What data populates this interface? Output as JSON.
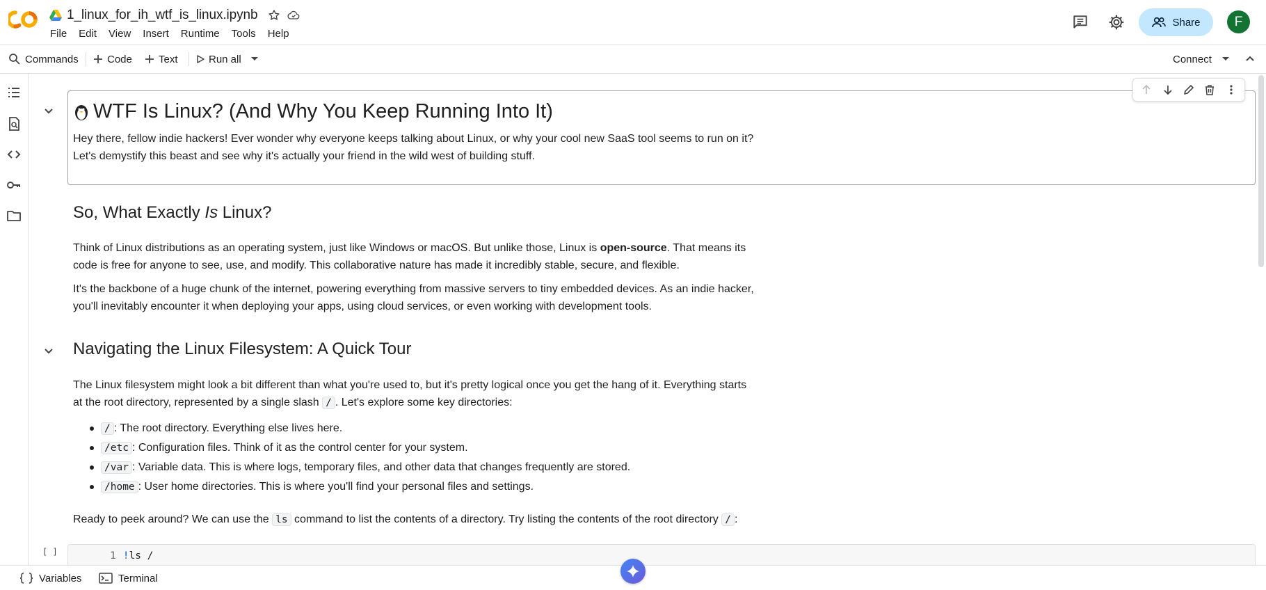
{
  "header": {
    "notebook_title": "1_linux_for_ih_wtf_is_linux.ipynb",
    "menu": [
      "File",
      "Edit",
      "View",
      "Insert",
      "Runtime",
      "Tools",
      "Help"
    ],
    "share_label": "Share",
    "avatar_initial": "F"
  },
  "toolbar": {
    "commands_label": "Commands",
    "code_label": "Code",
    "text_label": "Text",
    "run_all_label": "Run all",
    "connect_label": "Connect"
  },
  "notebook": {
    "h1_title": "WTF Is Linux? (And Why You Keep Running Into It)",
    "intro_line1": "Hey there, fellow indie hackers! Ever wonder why everyone keeps talking about Linux, or why your cool new SaaS tool seems to run on it?",
    "intro_line2": "Let's demystify this beast and see why it's actually your friend in the wild west of building stuff.",
    "h2_what_pre": "So, What Exactly ",
    "h2_what_em": "Is",
    "h2_what_post": " Linux?",
    "p1_pre": "Think of Linux distributions as an operating system, just like Windows or macOS. But unlike those, Linux is ",
    "p1_bold": "open-source",
    "p1_post1": ". That means its",
    "p1_line2": "code is free for anyone to see, use, and modify. This collaborative nature has made it incredibly stable, secure, and flexible.",
    "p2_line1": "It's the backbone of a huge chunk of the internet, powering everything from massive servers to tiny embedded devices. As an indie hacker,",
    "p2_line2": "you'll inevitably encounter it when deploying your apps, using cloud services, or even working with development tools.",
    "h2_nav": "Navigating the Linux Filesystem: A Quick Tour",
    "p3_line1": "The Linux filesystem might look a bit different than what you're used to, but it's pretty logical once you get the hang of it. Everything starts",
    "p3_line2_pre": "at the root directory, represented by a single slash ",
    "p3_code": "/",
    "p3_line2_post": ". Let's explore some key directories:",
    "dirs": [
      {
        "code": "/",
        "desc": ": The root directory. Everything else lives here."
      },
      {
        "code": "/etc",
        "desc": ": Configuration files. Think of it as the control center for your system."
      },
      {
        "code": "/var",
        "desc": ": Variable data. This is where logs, temporary files, and other data that changes frequently are stored."
      },
      {
        "code": "/home",
        "desc": ": User home directories. This is where you'll find your personal files and settings."
      }
    ],
    "p4_pre": "Ready to peek around? We can use the ",
    "p4_code1": "ls",
    "p4_mid": " command to list the contents of a directory. Try listing the contents of the root directory ",
    "p4_code2": "/",
    "p4_post": ":",
    "code_cell_bracket": "[ ]",
    "code_line_number": "1",
    "code_bang": "!",
    "code_text": "ls /"
  },
  "bottom": {
    "variables_label": "Variables",
    "terminal_label": "Terminal"
  },
  "colors": {
    "share_bg": "#c2e7ff",
    "avatar_bg": "#137333",
    "accent_blue": "#0b57d0"
  },
  "icons": [
    "colab-logo",
    "drive-icon",
    "star-icon",
    "cloud-icon",
    "comment-icon",
    "gear-icon",
    "people-icon",
    "search-icon",
    "plus-icon",
    "play-icon",
    "caret-down-icon",
    "chevron-up-icon",
    "toc-icon",
    "find-icon",
    "code-icon",
    "key-icon",
    "folder-icon",
    "arrow-up-icon",
    "arrow-down-icon",
    "pencil-icon",
    "trash-icon",
    "more-vert-icon",
    "chevron-down-icon",
    "penguin-emoji",
    "variables-icon",
    "terminal-icon",
    "gemini-icon"
  ]
}
